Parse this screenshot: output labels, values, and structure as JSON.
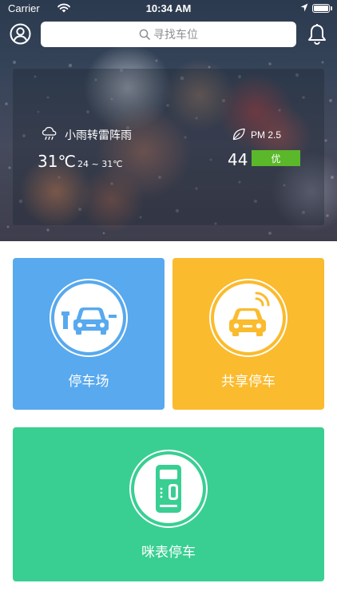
{
  "status_bar": {
    "carrier": "Carrier",
    "time": "10:34 AM"
  },
  "nav": {
    "search_placeholder": "寻找车位"
  },
  "weather": {
    "condition": "小雨转雷阵雨",
    "temperature": "31℃",
    "temperature_range": "24 ~ 31℃",
    "pm_label": "PM 2.5",
    "aqi_value": "44",
    "aqi_level": "优"
  },
  "cards": {
    "parking_lot": {
      "label": "停车场",
      "icon": "parking-gate-car-icon"
    },
    "shared_parking": {
      "label": "共享停车",
      "icon": "car-signal-icon"
    },
    "meter_parking": {
      "label": "咪表停车",
      "icon": "parking-meter-icon"
    }
  },
  "colors": {
    "parking_card": "#58a9ee",
    "shared_card": "#fbbb2e",
    "meter_card": "#39cf92",
    "aqi_badge": "#5bb82a"
  }
}
